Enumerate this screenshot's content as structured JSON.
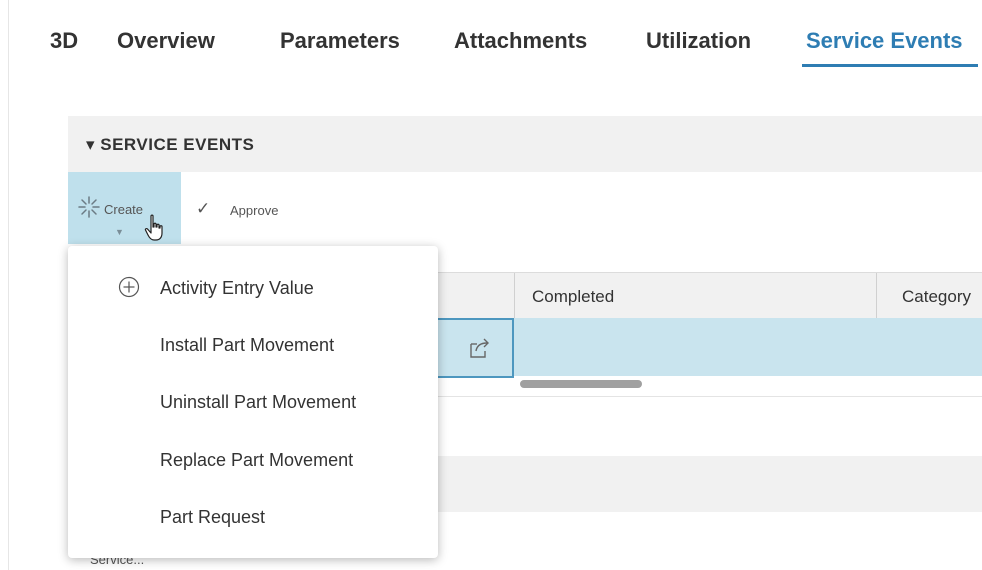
{
  "tabs": [
    {
      "label": "3D"
    },
    {
      "label": "Overview"
    },
    {
      "label": "Parameters"
    },
    {
      "label": "Attachments"
    },
    {
      "label": "Utilization"
    },
    {
      "label": "Service Events",
      "active": true
    }
  ],
  "section": {
    "title": "▾ SERVICE EVENTS"
  },
  "toolbar": {
    "create_label": "Create",
    "approve_label": "Approve",
    "create_icon": "sparkle-icon",
    "approve_icon": "checkmark-icon"
  },
  "dropdown": {
    "items": [
      {
        "label": "Activity Entry Value",
        "icon": "plus-circle-icon"
      },
      {
        "label": "Install Part Movement"
      },
      {
        "label": "Uninstall Part Movement"
      },
      {
        "label": "Replace Part Movement"
      },
      {
        "label": "Part Request"
      }
    ]
  },
  "grid": {
    "columns": [
      "Completed",
      "Category"
    ]
  },
  "footer": {
    "partial_item": "Service..."
  },
  "colors": {
    "accent": "#2e7db3",
    "selected_row": "#c9e4ee",
    "create_active": "#bfe0ec"
  }
}
